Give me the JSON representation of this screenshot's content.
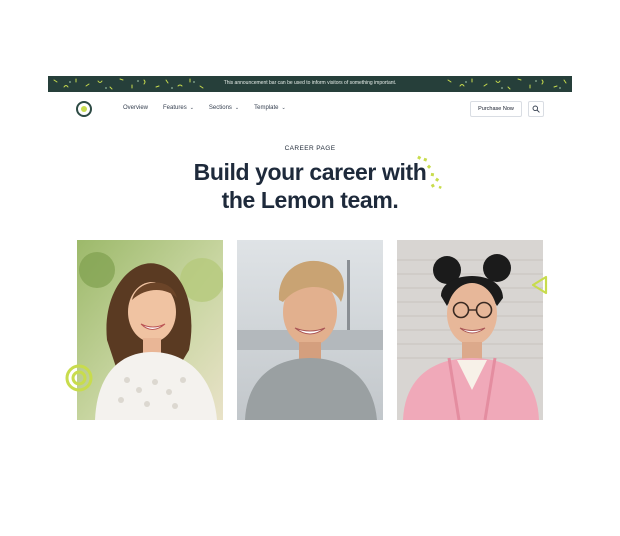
{
  "announcement": {
    "text": "This announcement bar can be used to inform visitors of something important."
  },
  "nav": {
    "logo_icon": "lemon-logo-icon",
    "links": [
      {
        "label": "Overview",
        "has_dropdown": false
      },
      {
        "label": "Features",
        "has_dropdown": true
      },
      {
        "label": "Sections",
        "has_dropdown": true
      },
      {
        "label": "Template",
        "has_dropdown": true
      }
    ],
    "purchase_label": "Purchase Now",
    "search_icon": "search-icon"
  },
  "hero": {
    "eyebrow": "CAREER PAGE",
    "title_line1": "Build your career with",
    "title_line2": "the Lemon team."
  },
  "photos": [
    {
      "name": "team-photo-woman-smiling"
    },
    {
      "name": "team-photo-man-smiling"
    },
    {
      "name": "team-photo-woman-glasses"
    }
  ],
  "colors": {
    "announcement_bg": "#263f3a",
    "accent": "#c8dc4d",
    "headline": "#1e2a3b"
  }
}
